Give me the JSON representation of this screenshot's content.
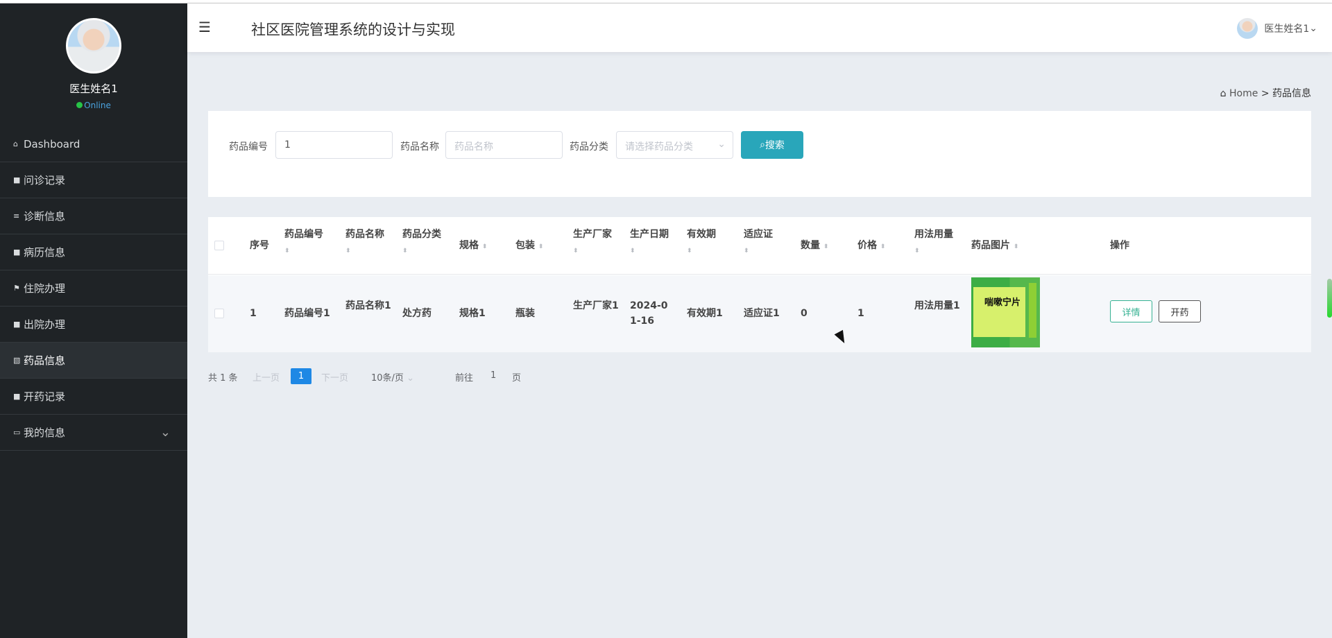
{
  "sidebar": {
    "doctor_name": "医生姓名1",
    "status": "Online",
    "items": [
      {
        "icon": "home-icon",
        "label": "Dashboard"
      },
      {
        "icon": "grid-icon",
        "label": "问诊记录"
      },
      {
        "icon": "list-icon",
        "label": "诊断信息"
      },
      {
        "icon": "grid-icon",
        "label": "病历信息"
      },
      {
        "icon": "flag-icon",
        "label": "住院办理"
      },
      {
        "icon": "grid-icon",
        "label": "出院办理"
      },
      {
        "icon": "picture-icon",
        "label": "药品信息"
      },
      {
        "icon": "grid-icon",
        "label": "开药记录"
      },
      {
        "icon": "calendar-icon",
        "label": "我的信息"
      }
    ]
  },
  "header": {
    "title": "社区医院管理系统的设计与实现",
    "user": "医生姓名1"
  },
  "breadcrumb": {
    "home": "Home",
    "separator": ">",
    "current": "药品信息"
  },
  "search": {
    "code_label": "药品编号",
    "code_value": "1",
    "name_label": "药品名称",
    "name_placeholder": "药品名称",
    "category_label": "药品分类",
    "category_placeholder": "请选择药品分类",
    "button": "搜索"
  },
  "table": {
    "headers": [
      "序号",
      "药品编号",
      "药品名称",
      "药品分类",
      "规格",
      "包装",
      "生产厂家",
      "生产日期",
      "有效期",
      "适应证",
      "数量",
      "价格",
      "用法用量",
      "药品图片",
      "操作"
    ],
    "rows": [
      {
        "seq": "1",
        "code": "药品编号1",
        "name": "药品名称1",
        "category": "处方药",
        "spec": "规格1",
        "package": "瓶装",
        "maker": "生产厂家1",
        "date": "2024-01-16",
        "expiry": "有效期1",
        "indication": "适应证1",
        "quantity": "0",
        "price": "1",
        "usage": "用法用量1",
        "image_text": "喘嗽宁片",
        "detail": "详情",
        "prescribe": "开药"
      }
    ]
  },
  "pagination": {
    "total": "共 1 条",
    "prev": "上一页",
    "page": "1",
    "next": "下一页",
    "size": "10条/页",
    "goto": "前往",
    "goto_page": "1",
    "unit": "页"
  }
}
